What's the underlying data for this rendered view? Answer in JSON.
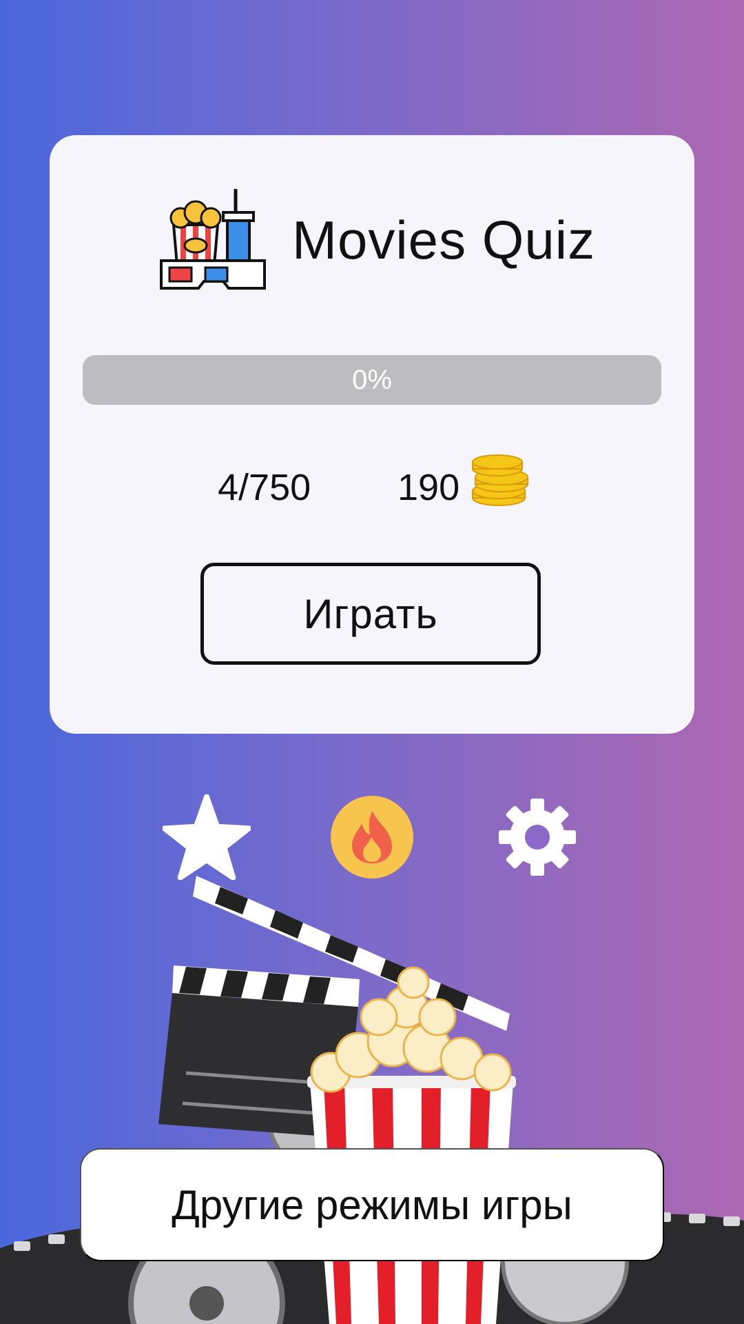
{
  "app": {
    "title": "Movies Quiz"
  },
  "progress": {
    "label": "0%",
    "fraction": 0.0
  },
  "stats": {
    "levels": "4/750",
    "coins": "190"
  },
  "buttons": {
    "play": "Играть",
    "other_modes": "Другие режимы игры"
  },
  "icons": [
    "cinema-logo-icon",
    "coin-stack-icon",
    "star-icon",
    "fire-icon",
    "gear-icon"
  ],
  "colors": {
    "accent_yellow": "#f7c44d",
    "fire": "#f0614b",
    "progress_track": "#bdbcc1"
  }
}
